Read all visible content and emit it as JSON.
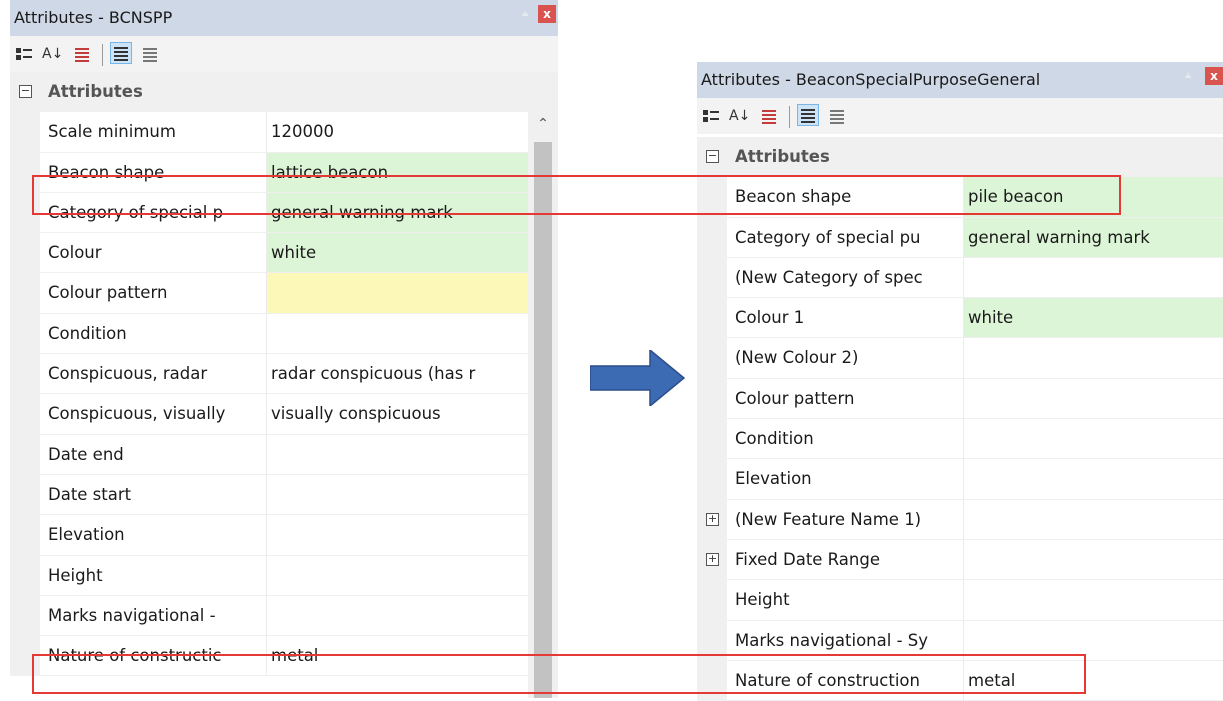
{
  "left_panel": {
    "title": "Attributes - BCNSPP",
    "pin_icon": "pin-icon",
    "close_label": "x",
    "category": "Attributes",
    "rows": [
      {
        "name": "Scale minimum",
        "value": "120000",
        "bg": ""
      },
      {
        "name": "Beacon shape",
        "value": "lattice beacon",
        "bg": "green"
      },
      {
        "name": "Category of special p",
        "value": "general warning mark",
        "bg": "green"
      },
      {
        "name": "Colour",
        "value": "white",
        "bg": "green"
      },
      {
        "name": "Colour pattern",
        "value": "",
        "bg": "yellow"
      },
      {
        "name": "Condition",
        "value": "",
        "bg": ""
      },
      {
        "name": "Conspicuous, radar",
        "value": "radar conspicuous (has r",
        "bg": ""
      },
      {
        "name": "Conspicuous, visually",
        "value": "visually conspicuous",
        "bg": ""
      },
      {
        "name": "Date end",
        "value": "",
        "bg": ""
      },
      {
        "name": "Date start",
        "value": "",
        "bg": ""
      },
      {
        "name": "Elevation",
        "value": "",
        "bg": ""
      },
      {
        "name": "Height",
        "value": "",
        "bg": ""
      },
      {
        "name": "Marks navigational -",
        "value": "",
        "bg": ""
      },
      {
        "name": "Nature of constructic",
        "value": "metal",
        "bg": ""
      }
    ]
  },
  "right_panel": {
    "title": "Attributes - BeaconSpecialPurposeGeneral",
    "pin_icon": "pin-icon",
    "close_label": "x",
    "category": "Attributes",
    "rows": [
      {
        "name": "Beacon shape",
        "value": "pile beacon",
        "bg": "green",
        "expandable": false
      },
      {
        "name": "Category of special pu",
        "value": "general warning mark",
        "bg": "green",
        "expandable": false
      },
      {
        "name": "(New Category of spec",
        "value": "",
        "bg": "",
        "expandable": false
      },
      {
        "name": "Colour 1",
        "value": "white",
        "bg": "green",
        "expandable": false
      },
      {
        "name": "(New Colour 2)",
        "value": "",
        "bg": "",
        "expandable": false
      },
      {
        "name": "Colour pattern",
        "value": "",
        "bg": "",
        "expandable": false
      },
      {
        "name": "Condition",
        "value": "",
        "bg": "",
        "expandable": false
      },
      {
        "name": "Elevation",
        "value": "",
        "bg": "",
        "expandable": false
      },
      {
        "name": "(New Feature Name 1)",
        "value": "",
        "bg": "",
        "expandable": true
      },
      {
        "name": "Fixed Date Range",
        "value": "",
        "bg": "",
        "expandable": true
      },
      {
        "name": "Height",
        "value": "",
        "bg": "",
        "expandable": false
      },
      {
        "name": "Marks navigational - Sy",
        "value": "",
        "bg": "",
        "expandable": false
      },
      {
        "name": "Nature of construction",
        "value": "metal",
        "bg": "",
        "expandable": false
      }
    ]
  },
  "toolbar_icons": [
    "categorized-icon",
    "sort-az-icon",
    "property-pages-icon",
    "view-icon-1",
    "view-icon-2"
  ],
  "colors": {
    "highlight": "#e53935",
    "arrow": "#3c6bb4",
    "green_cell": "#dcf5d7",
    "yellow_cell": "#fbf8b8",
    "titlebar": "#cfd8e6"
  }
}
